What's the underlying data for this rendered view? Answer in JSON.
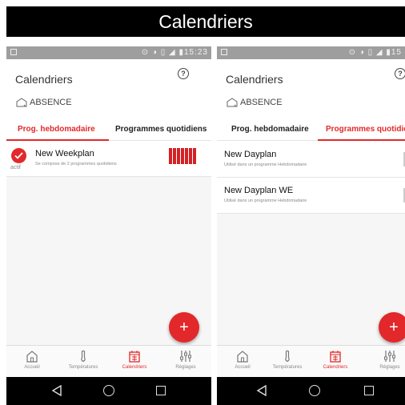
{
  "banner": {
    "title": "Calendriers"
  },
  "statusbar": {
    "time_left": "15:23",
    "time_right": "15"
  },
  "left_screen": {
    "app_title": "Calendriers",
    "absence_label": "ABSENCE",
    "tabs": [
      {
        "label": "Prog. hebdomadaire",
        "active": true
      },
      {
        "label": "Programmes quotidiens",
        "active": false
      }
    ],
    "weekplans": [
      {
        "title": "New Weekplan",
        "subtitle": "Se compose de 2 programmes quotidiens",
        "status": "actif",
        "day_bars": 7
      }
    ],
    "fab_label": "+"
  },
  "right_screen": {
    "app_title": "Calendriers",
    "absence_label": "ABSENCE",
    "tabs": [
      {
        "label": "Prog. hebdomadaire",
        "active": false
      },
      {
        "label": "Programmes quotidiens",
        "active": true
      }
    ],
    "dayplans": [
      {
        "title": "New Dayplan",
        "subtitle": "Utilisé dans un programme Hebdomadaire"
      },
      {
        "title": "New Dayplan WE",
        "subtitle": "Utilisé dans un programme Hebdomadaire"
      }
    ],
    "fab_label": "+"
  },
  "bottom_nav": [
    {
      "label": "Accueil",
      "icon": "home-icon",
      "active": false
    },
    {
      "label": "Températures",
      "icon": "thermometer-icon",
      "active": false
    },
    {
      "label": "Calendriers",
      "icon": "calendar-icon",
      "active": true
    },
    {
      "label": "Réglages",
      "icon": "sliders-icon",
      "active": false
    }
  ],
  "colors": {
    "accent": "#e2282a",
    "banner_bg": "#000000",
    "statusbar": "#9e9e9e"
  }
}
